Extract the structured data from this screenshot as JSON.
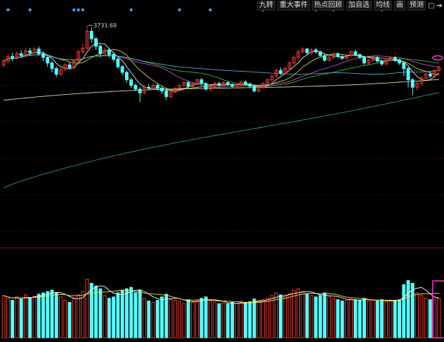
{
  "toolbar": {
    "buttons": [
      "九转",
      "重大事件",
      "热点回顾",
      "加自选",
      "均线",
      "画",
      "预测"
    ],
    "lock_icon": "lock-icon",
    "exit_icon": "exit-icon"
  },
  "colors": {
    "background": "#000000",
    "up": "#e8382e",
    "down": "#54ffff",
    "grid": "#3a0d0d",
    "separator": "#7a1a1a",
    "ma5": "#ffffff",
    "ma10": "#f0e442",
    "ma20": "#d05bd0",
    "ma30": "#4ec94e",
    "ma60": "#5ab4d6",
    "ma120": "#ffffcc",
    "ma250": "#3aa8a8",
    "marker": "#ff33cc",
    "event_diamond": "#3fa8ff"
  },
  "chart_data": {
    "type": "candlestick",
    "annotation": "3731.69",
    "high_marker": 3731.69,
    "price_range": [
      2550,
      3800
    ],
    "volume_range": [
      0,
      100
    ],
    "candles": [
      [
        3520,
        3540,
        3555,
        3505,
        62
      ],
      [
        3540,
        3565,
        3580,
        3530,
        58
      ],
      [
        3565,
        3555,
        3585,
        3540,
        55
      ],
      [
        3555,
        3580,
        3595,
        3548,
        60
      ],
      [
        3580,
        3570,
        3598,
        3555,
        57
      ],
      [
        3570,
        3595,
        3610,
        3562,
        63
      ],
      [
        3595,
        3585,
        3612,
        3570,
        59
      ],
      [
        3585,
        3605,
        3618,
        3578,
        61
      ],
      [
        3605,
        3580,
        3620,
        3568,
        64
      ],
      [
        3580,
        3560,
        3592,
        3540,
        66
      ],
      [
        3560,
        3530,
        3568,
        3510,
        68
      ],
      [
        3530,
        3500,
        3540,
        3480,
        70
      ],
      [
        3500,
        3470,
        3510,
        3455,
        66
      ],
      [
        3470,
        3495,
        3505,
        3460,
        60
      ],
      [
        3495,
        3520,
        3530,
        3488,
        55
      ],
      [
        3520,
        3505,
        3535,
        3495,
        52
      ],
      [
        3505,
        3540,
        3550,
        3498,
        57
      ],
      [
        3540,
        3590,
        3600,
        3535,
        63
      ],
      [
        3590,
        3610,
        3630,
        3580,
        68
      ],
      [
        3610,
        3700,
        3731.69,
        3600,
        86
      ],
      [
        3700,
        3660,
        3720,
        3640,
        80
      ],
      [
        3660,
        3620,
        3670,
        3600,
        76
      ],
      [
        3620,
        3580,
        3630,
        3560,
        72
      ],
      [
        3580,
        3600,
        3610,
        3568,
        62
      ],
      [
        3600,
        3575,
        3612,
        3560,
        58
      ],
      [
        3575,
        3550,
        3585,
        3538,
        60
      ],
      [
        3550,
        3510,
        3560,
        3500,
        66
      ],
      [
        3510,
        3480,
        3520,
        3465,
        70
      ],
      [
        3480,
        3440,
        3490,
        3425,
        72
      ],
      [
        3440,
        3410,
        3450,
        3395,
        74
      ],
      [
        3410,
        3390,
        3420,
        3378,
        66
      ],
      [
        3390,
        3370,
        3402,
        3320,
        70
      ],
      [
        3370,
        3400,
        3410,
        3362,
        58
      ],
      [
        3400,
        3395,
        3418,
        3385,
        54
      ],
      [
        3395,
        3410,
        3420,
        3385,
        52
      ],
      [
        3410,
        3395,
        3422,
        3382,
        55
      ],
      [
        3395,
        3380,
        3405,
        3365,
        60
      ],
      [
        3380,
        3350,
        3392,
        3332,
        64
      ],
      [
        3350,
        3375,
        3385,
        3340,
        56
      ],
      [
        3375,
        3395,
        3400,
        3368,
        55
      ],
      [
        3395,
        3410,
        3418,
        3388,
        53
      ],
      [
        3410,
        3425,
        3432,
        3402,
        50
      ],
      [
        3425,
        3405,
        3435,
        3398,
        56
      ],
      [
        3405,
        3420,
        3428,
        3395,
        52
      ],
      [
        3420,
        3440,
        3448,
        3412,
        55
      ],
      [
        3440,
        3420,
        3450,
        3408,
        58
      ],
      [
        3420,
        3390,
        3428,
        3380,
        60
      ],
      [
        3390,
        3405,
        3412,
        3380,
        54
      ],
      [
        3405,
        3420,
        3428,
        3398,
        52
      ],
      [
        3420,
        3410,
        3430,
        3402,
        50
      ],
      [
        3410,
        3425,
        3432,
        3404,
        51
      ],
      [
        3425,
        3415,
        3432,
        3406,
        50
      ],
      [
        3415,
        3405,
        3422,
        3396,
        52
      ],
      [
        3405,
        3415,
        3420,
        3398,
        50
      ],
      [
        3415,
        3428,
        3435,
        3408,
        52
      ],
      [
        3428,
        3418,
        3436,
        3410,
        51
      ],
      [
        3418,
        3405,
        3425,
        3396,
        53
      ],
      [
        3405,
        3380,
        3412,
        3370,
        57
      ],
      [
        3380,
        3400,
        3408,
        3372,
        55
      ],
      [
        3400,
        3420,
        3428,
        3392,
        56
      ],
      [
        3420,
        3440,
        3448,
        3412,
        58
      ],
      [
        3440,
        3460,
        3468,
        3430,
        62
      ],
      [
        3460,
        3490,
        3500,
        3452,
        66
      ],
      [
        3490,
        3475,
        3505,
        3465,
        63
      ],
      [
        3475,
        3500,
        3510,
        3468,
        61
      ],
      [
        3500,
        3530,
        3540,
        3490,
        65
      ],
      [
        3530,
        3560,
        3572,
        3520,
        70
      ],
      [
        3560,
        3590,
        3600,
        3548,
        72
      ],
      [
        3590,
        3605,
        3615,
        3578,
        68
      ],
      [
        3605,
        3585,
        3612,
        3572,
        64
      ],
      [
        3585,
        3600,
        3610,
        3575,
        62
      ],
      [
        3600,
        3590,
        3612,
        3580,
        60
      ],
      [
        3590,
        3570,
        3598,
        3560,
        62
      ],
      [
        3570,
        3545,
        3580,
        3535,
        66
      ],
      [
        3545,
        3560,
        3570,
        3538,
        60
      ],
      [
        3560,
        3580,
        3590,
        3552,
        58
      ],
      [
        3580,
        3565,
        3588,
        3556,
        56
      ],
      [
        3565,
        3555,
        3575,
        3545,
        54
      ],
      [
        3555,
        3570,
        3578,
        3546,
        55
      ],
      [
        3570,
        3590,
        3598,
        3562,
        57
      ],
      [
        3590,
        3575,
        3600,
        3566,
        56
      ],
      [
        3575,
        3560,
        3582,
        3552,
        55
      ],
      [
        3560,
        3530,
        3568,
        3520,
        58
      ],
      [
        3530,
        3545,
        3552,
        3522,
        54
      ],
      [
        3545,
        3560,
        3568,
        3538,
        55
      ],
      [
        3560,
        3540,
        3566,
        3530,
        54
      ],
      [
        3540,
        3525,
        3548,
        3515,
        56
      ],
      [
        3525,
        3545,
        3552,
        3518,
        53
      ],
      [
        3545,
        3560,
        3568,
        3538,
        54
      ],
      [
        3560,
        3545,
        3566,
        3536,
        55
      ],
      [
        3545,
        3530,
        3552,
        3520,
        56
      ],
      [
        3530,
        3500,
        3538,
        3460,
        78
      ],
      [
        3500,
        3440,
        3510,
        3400,
        84
      ],
      [
        3440,
        3400,
        3450,
        3360,
        80
      ],
      [
        3400,
        3420,
        3430,
        3385,
        66
      ],
      [
        3420,
        3450,
        3460,
        3410,
        62
      ],
      [
        3450,
        3470,
        3480,
        3440,
        58
      ],
      [
        3470,
        3460,
        3485,
        3450,
        56
      ],
      [
        3460,
        3490,
        3498,
        3452,
        57
      ],
      [
        3490,
        3505,
        3515,
        3482,
        58
      ]
    ]
  }
}
